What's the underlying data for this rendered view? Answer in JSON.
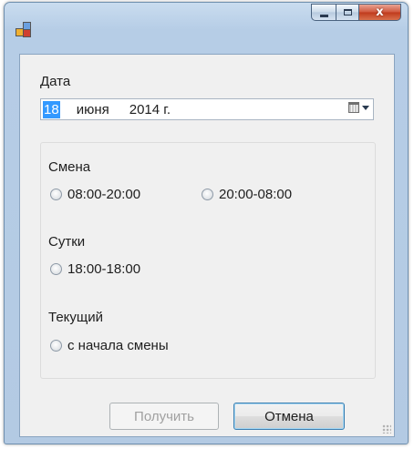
{
  "window": {
    "title": "",
    "controls": {
      "minimize_icon": "minimize-icon",
      "maximize_icon": "maximize-icon",
      "close_glyph": "x"
    }
  },
  "date": {
    "label": "Дата",
    "day": "18",
    "month": "июня",
    "year": "2014 г.",
    "calendar_icon": "calendar-icon"
  },
  "shift": {
    "label": "Смена",
    "options": [
      "08:00-20:00",
      "20:00-08:00"
    ]
  },
  "day_period": {
    "label": "Сутки",
    "options": [
      "18:00-18:00"
    ]
  },
  "current": {
    "label": "Текущий",
    "options": [
      "с начала смены"
    ]
  },
  "buttons": {
    "get_label": "Получить",
    "cancel_label": "Отмена"
  },
  "colors": {
    "selection": "#3399ff",
    "close_button": "#c03a1c",
    "client_bg": "#f0f0f0"
  }
}
